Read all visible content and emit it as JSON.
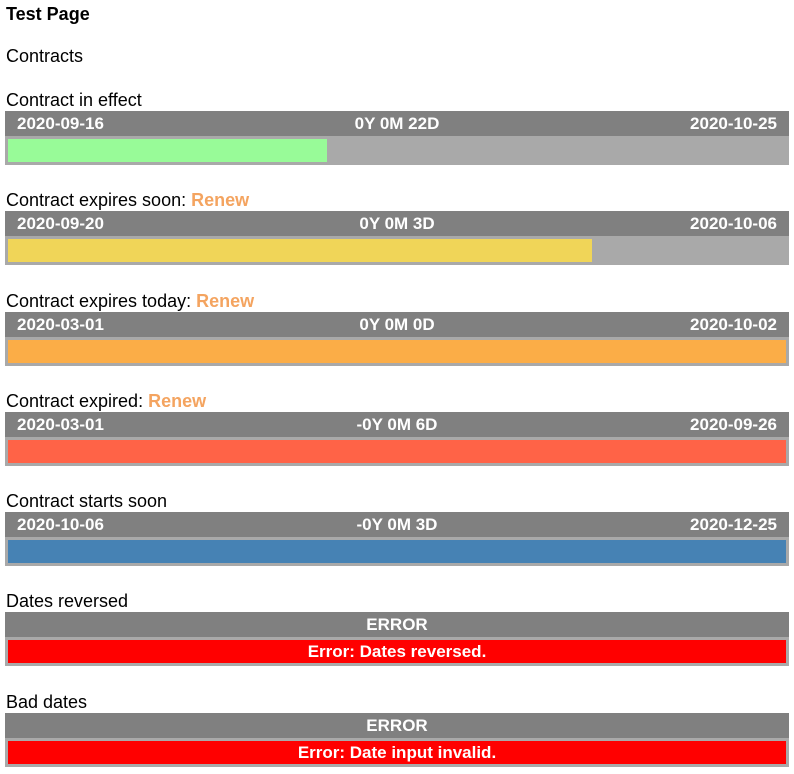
{
  "title": "Test Page",
  "subtitle": "Contracts",
  "renew_label": "Renew",
  "contracts": [
    {
      "label": "Contract in effect",
      "start": "2020-09-16",
      "duration": "0Y 0M 22D",
      "end": "2020-10-25",
      "progress": 0.41,
      "color": "#98fb98"
    },
    {
      "label": "Contract expires soon:",
      "start": "2020-09-20",
      "duration": "0Y 0M 3D",
      "end": "2020-10-06",
      "progress": 0.75,
      "color": "#f0d558"
    },
    {
      "label": "Contract expires today:",
      "start": "2020-03-01",
      "duration": "0Y 0M 0D",
      "end": "2020-10-02",
      "progress": 1,
      "color": "#fbad47"
    },
    {
      "label": "Contract expired:",
      "start": "2020-03-01",
      "duration": "-0Y 0M 6D",
      "end": "2020-09-26",
      "progress": 1,
      "color": "#ff6347"
    },
    {
      "label": "Contract starts soon",
      "start": "2020-10-06",
      "duration": "-0Y 0M 3D",
      "end": "2020-12-25",
      "progress": 1,
      "color": "#4682b4"
    }
  ],
  "errors": [
    {
      "label": "Dates reversed",
      "header": "ERROR",
      "message": "Error: Dates reversed."
    },
    {
      "label": "Bad dates",
      "header": "ERROR",
      "message": "Error: Date input invalid."
    }
  ]
}
